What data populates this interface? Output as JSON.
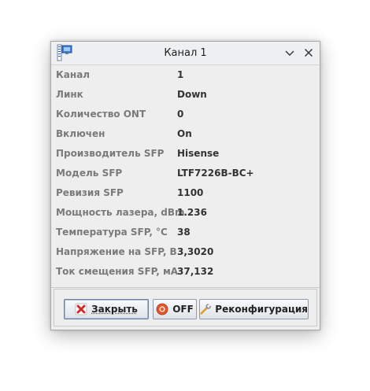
{
  "window": {
    "title": "Канал 1"
  },
  "fields": [
    {
      "label": "Канал",
      "value": "1"
    },
    {
      "label": "Линк",
      "value": "Down"
    },
    {
      "label": "Количество ONT",
      "value": "0"
    },
    {
      "label": "Включен",
      "value": "On"
    },
    {
      "label": "Производитель SFP",
      "value": "Hisense"
    },
    {
      "label": "Модель SFP",
      "value": "LTF7226B-BC+"
    },
    {
      "label": "Ревизия SFP",
      "value": "1100"
    },
    {
      "label": "Мощность лазера, dBm",
      "value": "1.236"
    },
    {
      "label": "Температура SFP, °C",
      "value": "38"
    },
    {
      "label": "Напряжение на SFP, В",
      "value": "3,3020"
    },
    {
      "label": "Ток смещения SFP, мА",
      "value": "37,132"
    }
  ],
  "buttons": {
    "close": {
      "label": "Закрыть",
      "icon": "red-x-icon"
    },
    "off": {
      "label": "OFF",
      "icon": "power-button-icon"
    },
    "reconfigure": {
      "label": "Реконфигурация",
      "icon": "wrench-icon"
    }
  },
  "colors": {
    "label_text": "#7a7a7a",
    "value_text": "#333333",
    "window_bg": "#eeeeee",
    "button_border": "#8c9bb0"
  }
}
